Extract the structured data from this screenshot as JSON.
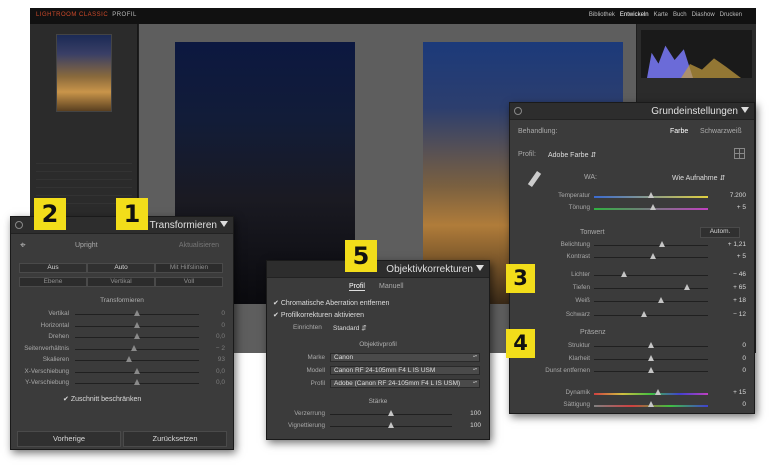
{
  "app": {
    "logo": "LIGHTROOM CLASSIC",
    "brand": "PROFIL",
    "modules": [
      "Bibliothek",
      "Entwickeln",
      "Karte",
      "Buch",
      "Diashow",
      "Drucken"
    ]
  },
  "transform_panel": {
    "title": "Transformieren",
    "upright_label": "Upright",
    "update_label": "Aktualisieren",
    "buttons_row1": [
      "Aus",
      "Auto",
      "Mit Hilfslinien"
    ],
    "buttons_row2": [
      "Ebene",
      "Vertikal",
      "Voll"
    ],
    "section_label": "Transformieren",
    "sliders": [
      {
        "label": "Vertikal",
        "value": "0",
        "pos": 0.5
      },
      {
        "label": "Horizontal",
        "value": "0",
        "pos": 0.5
      },
      {
        "label": "Drehen",
        "value": "0,0",
        "pos": 0.5
      },
      {
        "label": "Seitenverhältnis",
        "value": "− 2",
        "pos": 0.48
      },
      {
        "label": "Skalieren",
        "value": "93",
        "pos": 0.44
      },
      {
        "label": "X-Verschiebung",
        "value": "0,0",
        "pos": 0.5
      },
      {
        "label": "Y-Verschiebung",
        "value": "0,0",
        "pos": 0.5
      }
    ],
    "crop_label": "Zuschnitt beschränken",
    "prev_button": "Vorherige",
    "reset_button": "Zurücksetzen"
  },
  "lens_panel": {
    "title": "Objektivkorrekturen",
    "tabs": [
      "Profil",
      "Manuell"
    ],
    "chromatic_label": "Chromatische Aberration entfernen",
    "profile_corr_label": "Profilkorrekturen aktivieren",
    "setup_label": "Einrichten",
    "setup_value": "Standard",
    "section_label": "Objektivprofil",
    "make_label": "Marke",
    "make_value": "Canon",
    "model_label": "Modell",
    "model_value": "Canon RF 24-105mm F4 L IS USM",
    "profile_label": "Profil",
    "profile_value": "Adobe (Canon RF 24-105mm F4 L IS USM)",
    "amount_label": "Stärke",
    "sliders": [
      {
        "label": "Verzerrung",
        "value": "100",
        "pos": 0.5
      },
      {
        "label": "Vignettierung",
        "value": "100",
        "pos": 0.5
      }
    ]
  },
  "basic_panel": {
    "title": "Grundeinstellungen",
    "treatment_label": "Behandlung:",
    "color_btn": "Farbe",
    "bw_btn": "Schwarzweiß",
    "profile_label": "Profil:",
    "profile_value": "Adobe Farbe",
    "wb_label": "WA:",
    "wb_value": "Wie Aufnahme",
    "wb_sliders": [
      {
        "label": "Temperatur",
        "value": "7.200",
        "pos": 0.5
      },
      {
        "label": "Tönung",
        "value": "+ 5",
        "pos": 0.52
      }
    ],
    "tone_label": "Tonwert",
    "auto_label": "Autom.",
    "tone_sliders": [
      {
        "label": "Belichtung",
        "value": "+ 1,21",
        "pos": 0.6
      },
      {
        "label": "Kontrast",
        "value": "+ 5",
        "pos": 0.52
      }
    ],
    "light_sliders": [
      {
        "label": "Lichter",
        "value": "− 46",
        "pos": 0.27
      },
      {
        "label": "Tiefen",
        "value": "+ 65",
        "pos": 0.82
      },
      {
        "label": "Weiß",
        "value": "+ 18",
        "pos": 0.59
      },
      {
        "label": "Schwarz",
        "value": "− 12",
        "pos": 0.44
      }
    ],
    "presence_label": "Präsenz",
    "presence_sliders": [
      {
        "label": "Struktur",
        "value": "0",
        "pos": 0.5
      },
      {
        "label": "Klarheit",
        "value": "0",
        "pos": 0.5
      },
      {
        "label": "Dunst entfernen",
        "value": "0",
        "pos": 0.5
      }
    ],
    "color_sliders": [
      {
        "label": "Dynamik",
        "value": "+ 15",
        "pos": 0.57
      },
      {
        "label": "Sättigung",
        "value": "0",
        "pos": 0.5
      }
    ]
  },
  "badges": [
    "1",
    "2",
    "3",
    "4",
    "5"
  ]
}
